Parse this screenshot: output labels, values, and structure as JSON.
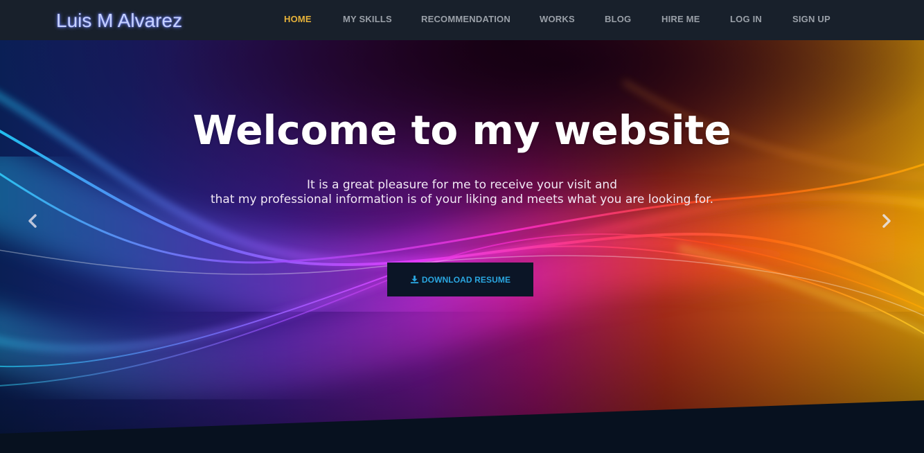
{
  "brand": {
    "name": "Luis M Alvarez"
  },
  "nav": {
    "items": [
      {
        "label": "HOME",
        "active": true
      },
      {
        "label": "MY SKILLS",
        "active": false
      },
      {
        "label": "RECOMMENDATION",
        "active": false
      },
      {
        "label": "WORKS",
        "active": false
      },
      {
        "label": "BLOG",
        "active": false
      },
      {
        "label": "HIRE ME",
        "active": false
      },
      {
        "label": "LOG IN",
        "active": false
      },
      {
        "label": "SIGN UP",
        "active": false
      }
    ]
  },
  "hero": {
    "title": "Welcome to my website",
    "subtitle_line1": "It is a great pleasure for me to receive your visit and",
    "subtitle_line2": "that my professional information is of your liking and meets what you are looking for.",
    "cta_label": "DOWNLOAD RESUME",
    "cta_icon": "download-icon",
    "prev_icon": "chevron-left-icon",
    "next_icon": "chevron-right-icon"
  },
  "colors": {
    "navbar_bg": "#18202b",
    "nav_active": "#e6b23a",
    "nav_text": "#9aa0a8",
    "cta_bg": "#0b1526",
    "cta_text": "#2aa6e0",
    "page_bottom": "#07111f"
  }
}
